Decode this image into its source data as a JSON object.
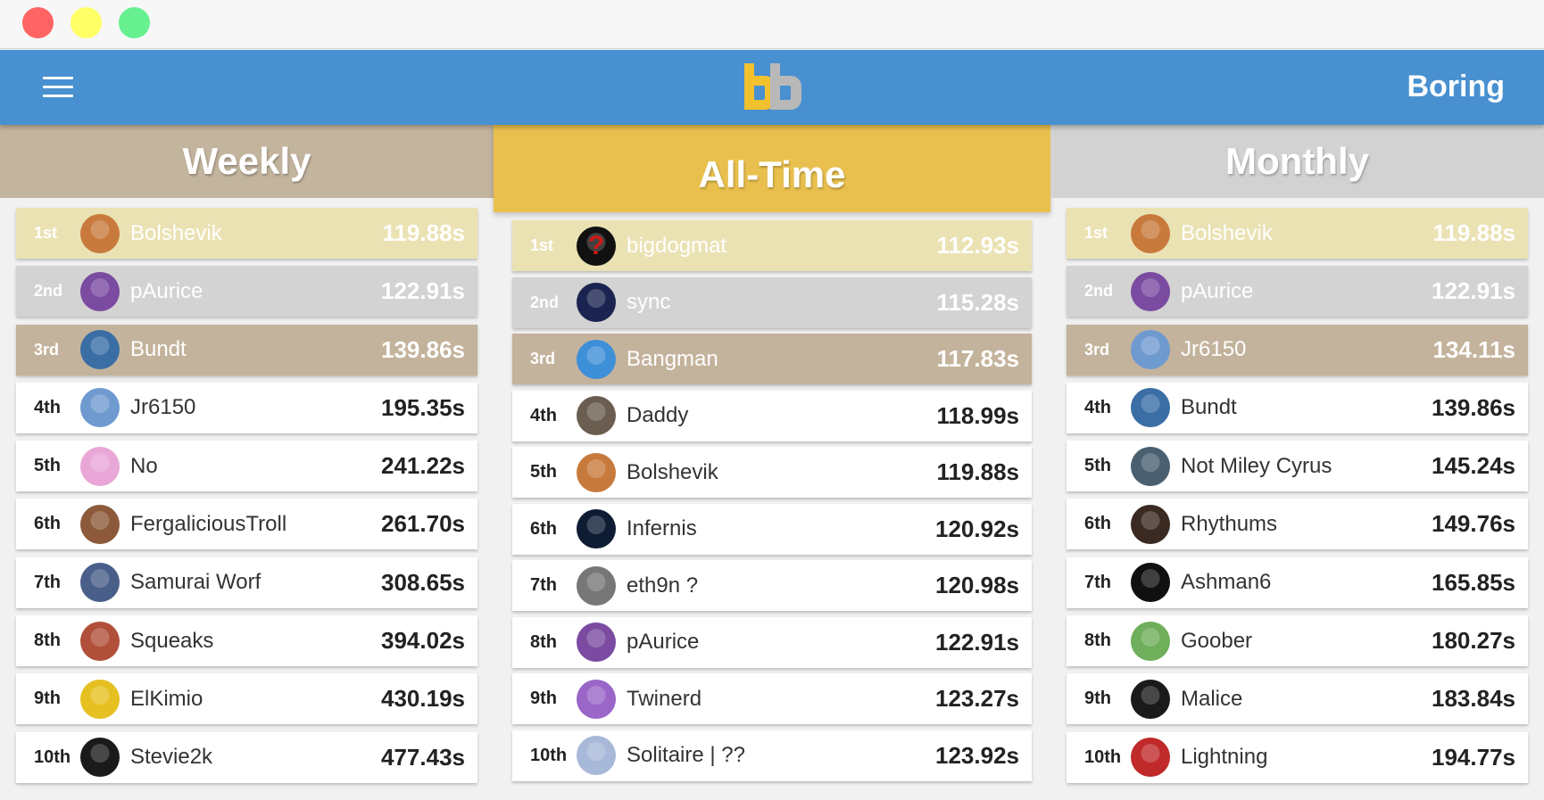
{
  "header": {
    "menu_icon": "hamburger-menu-icon",
    "logo_icon": "bb-logo-icon",
    "title": "Boring",
    "colors": {
      "appbar": "#4890d0",
      "logo_yellow": "#f2c12e",
      "logo_gray": "#b8b8b8"
    }
  },
  "panels": [
    {
      "label": "Weekly",
      "color": "#c3b49e",
      "entries": [
        {
          "rank": "1st",
          "name": "Bolshevik",
          "time": "119.88s",
          "avatar": "monkey-avatar",
          "avatar_color": "#c87a3c"
        },
        {
          "rank": "2nd",
          "name": "pAurice",
          "time": "122.91s",
          "avatar": "crowned-frog-avatar",
          "avatar_color": "#7a4ba0"
        },
        {
          "rank": "3rd",
          "name": "Bundt",
          "time": "139.86s",
          "avatar": "sunglasses-face-avatar",
          "avatar_color": "#3a6ea5"
        },
        {
          "rank": "4th",
          "name": "Jr6150",
          "time": "195.35s",
          "avatar": "chicken-avatar",
          "avatar_color": "#6f9ad0"
        },
        {
          "rank": "5th",
          "name": "No",
          "time": "241.22s",
          "avatar": "pink-cartoon-avatar",
          "avatar_color": "#e9a7d8"
        },
        {
          "rank": "6th",
          "name": "FergaliciousTroll",
          "time": "261.70s",
          "avatar": "portrait-avatar",
          "avatar_color": "#8c5a3a"
        },
        {
          "rank": "7th",
          "name": "Samurai Worf",
          "time": "308.65s",
          "avatar": "emblem-avatar",
          "avatar_color": "#4a5e8a"
        },
        {
          "rank": "8th",
          "name": "Squeaks",
          "time": "394.02s",
          "avatar": "anime-girl-avatar",
          "avatar_color": "#b0503a"
        },
        {
          "rank": "9th",
          "name": "ElKimio",
          "time": "430.19s",
          "avatar": "yellow-logo-avatar",
          "avatar_color": "#e6c020"
        },
        {
          "rank": "10th",
          "name": "Stevie2k",
          "time": "477.43s",
          "avatar": "dark-swirl-avatar",
          "avatar_color": "#1a1a1a"
        }
      ]
    },
    {
      "label": "All-Time",
      "color": "#e9c04e",
      "entries": [
        {
          "rank": "1st",
          "name": "bigdogmat",
          "time": "112.93s",
          "avatar": "question-mark-avatar",
          "avatar_color": "#111111"
        },
        {
          "rank": "2nd",
          "name": "sync",
          "time": "115.28s",
          "avatar": "blue-creature-avatar",
          "avatar_color": "#1b2450"
        },
        {
          "rank": "3rd",
          "name": "Bangman",
          "time": "117.83s",
          "avatar": "cartoon-face-avatar",
          "avatar_color": "#3d8fd8"
        },
        {
          "rank": "4th",
          "name": "Daddy",
          "time": "118.99s",
          "avatar": "sunglasses-man-avatar",
          "avatar_color": "#6b5e50"
        },
        {
          "rank": "5th",
          "name": "Bolshevik",
          "time": "119.88s",
          "avatar": "monkey-avatar",
          "avatar_color": "#c87a3c"
        },
        {
          "rank": "6th",
          "name": "Infernis",
          "time": "120.92s",
          "avatar": "dark-blue-avatar",
          "avatar_color": "#0d1b33"
        },
        {
          "rank": "7th",
          "name": "eth9n ?",
          "time": "120.98s",
          "avatar": "bw-character-avatar",
          "avatar_color": "#777777"
        },
        {
          "rank": "8th",
          "name": "pAurice",
          "time": "122.91s",
          "avatar": "crowned-frog-avatar",
          "avatar_color": "#7a4ba0"
        },
        {
          "rank": "9th",
          "name": "Twinerd",
          "time": "123.27s",
          "avatar": "purple-creature-avatar",
          "avatar_color": "#9a66c8"
        },
        {
          "rank": "10th",
          "name": "Solitaire | ??",
          "time": "123.92s",
          "avatar": "white-hair-avatar",
          "avatar_color": "#a8b8d8"
        }
      ]
    },
    {
      "label": "Monthly",
      "color": "#d2d2d2",
      "entries": [
        {
          "rank": "1st",
          "name": "Bolshevik",
          "time": "119.88s",
          "avatar": "monkey-avatar",
          "avatar_color": "#c87a3c"
        },
        {
          "rank": "2nd",
          "name": "pAurice",
          "time": "122.91s",
          "avatar": "crowned-frog-avatar",
          "avatar_color": "#7a4ba0"
        },
        {
          "rank": "3rd",
          "name": "Jr6150",
          "time": "134.11s",
          "avatar": "chicken-avatar",
          "avatar_color": "#6f9ad0"
        },
        {
          "rank": "4th",
          "name": "Bundt",
          "time": "139.86s",
          "avatar": "sunglasses-face-avatar",
          "avatar_color": "#3a6ea5"
        },
        {
          "rank": "5th",
          "name": "Not Miley Cyrus",
          "time": "145.24s",
          "avatar": "shark-avatar",
          "avatar_color": "#4a6070"
        },
        {
          "rank": "6th",
          "name": "Rhythums",
          "time": "149.76s",
          "avatar": "dark-figure-avatar",
          "avatar_color": "#3a2a22"
        },
        {
          "rank": "7th",
          "name": "Ashman6",
          "time": "165.85s",
          "avatar": "text-logo-avatar",
          "avatar_color": "#101010"
        },
        {
          "rank": "8th",
          "name": "Goober",
          "time": "180.27s",
          "avatar": "green-creature-avatar",
          "avatar_color": "#6fae5a"
        },
        {
          "rank": "9th",
          "name": "Malice",
          "time": "183.84s",
          "avatar": "bw-face-avatar",
          "avatar_color": "#1a1a1a"
        },
        {
          "rank": "10th",
          "name": "Lightning",
          "time": "194.77s",
          "avatar": "red-character-avatar",
          "avatar_color": "#c02a2a"
        }
      ]
    }
  ]
}
